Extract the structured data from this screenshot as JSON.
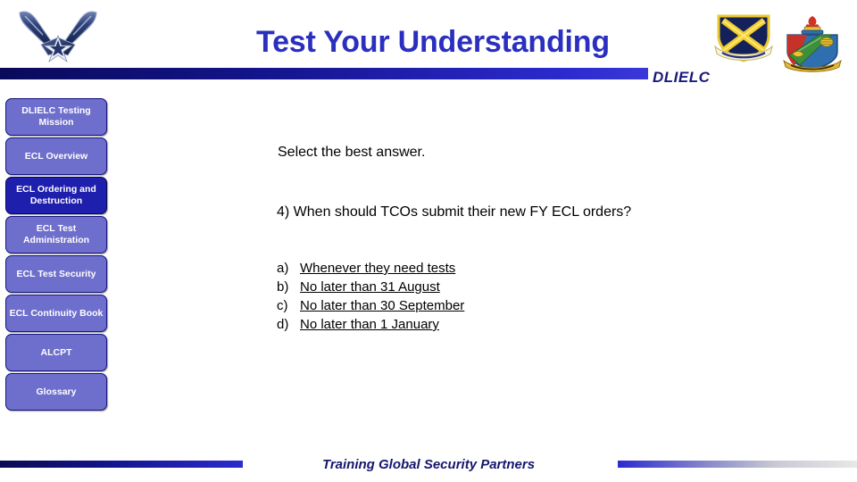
{
  "header": {
    "title": "Test Your Understanding",
    "org_label": "DLIELC",
    "af_logo_name": "air-force-wings-logo",
    "shield_emblem_name": "air-education-training-command-shield",
    "crest_emblem_name": "dlielc-crest-emblem",
    "bar_color_start": "#0A0A5A",
    "bar_color_end": "#3A38D8",
    "title_color": "#2B2FBF"
  },
  "sidebar": {
    "items": [
      {
        "label": "DLIELC Testing Mission",
        "name": "sidebar-item-dlielc-testing-mission",
        "active": false
      },
      {
        "label": "ECL Overview",
        "name": "sidebar-item-ecl-overview",
        "active": false
      },
      {
        "label": "ECL Ordering and Destruction",
        "name": "sidebar-item-ecl-ordering-and-destruction",
        "active": true
      },
      {
        "label": "ECL Test Administration",
        "name": "sidebar-item-ecl-test-administration",
        "active": false
      },
      {
        "label": "ECL Test Security",
        "name": "sidebar-item-ecl-test-security",
        "active": false
      },
      {
        "label": "ECL Continuity Book",
        "name": "sidebar-item-ecl-continuity-book",
        "active": false
      },
      {
        "label": "ALCPT",
        "name": "sidebar-item-alcpt",
        "active": false
      },
      {
        "label": "Glossary",
        "name": "sidebar-item-glossary",
        "active": false
      }
    ],
    "button_color": "#6E6ECD",
    "active_color": "#1F1FAE"
  },
  "main": {
    "prompt": "Select the best answer.",
    "question_number": "4)",
    "question": "4)  When should TCOs submit their new FY ECL orders?",
    "answers": [
      {
        "letter": "a)",
        "text": "Whenever they need tests"
      },
      {
        "letter": "b)",
        "text": "No later than 31 August"
      },
      {
        "letter": "c)",
        "text": "No later than 30 September"
      },
      {
        "letter": "d)",
        "text": "No later than 1 January"
      }
    ]
  },
  "footer": {
    "tagline": "Training Global Security Partners",
    "tagline_color": "#16166E"
  }
}
